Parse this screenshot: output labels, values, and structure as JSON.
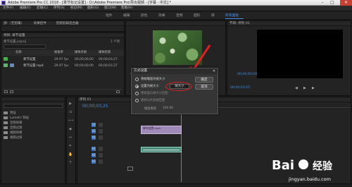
{
  "window": {
    "title": "Adobe Premiere Pro CC 2018 - [章节标记设置] - D:\\Adobe Premiere Pro\\导出视频 - [字幕 - 中文] *",
    "minimize": "–",
    "maximize": "□",
    "close": "✕"
  },
  "menu": [
    "文件(F)",
    "编辑(E)",
    "剪辑(C)",
    "序列(S)",
    "标记(M)",
    "图形(G)",
    "窗口(W)",
    "帮助(H)"
  ],
  "workspaces": [
    "组件",
    "编辑",
    "颜色",
    "效果",
    "音频",
    "图形",
    "库",
    "所有面板"
  ],
  "workspace_active": "所有面板",
  "source_panel": {
    "tab": "源:（无剪辑）",
    "tab2": "效果控件",
    "tab3": "音频剪辑混合器"
  },
  "program_panel": {
    "tab": "节目: 序列 01",
    "timecode_left": "00;00;03;25",
    "timecode_right": "00;00;03;25",
    "timecode_mid": "00;00;00;00"
  },
  "project_panel": {
    "title": "项目: 章节设置",
    "file": "章节设置.prproj",
    "count": "1 个项",
    "columns": [
      "名称",
      "帧速率",
      "媒体开始",
      "媒体结束"
    ],
    "items": [
      {
        "name": "章节设置",
        "fps": "29.97 fps",
        "start": "00;00;00;00",
        "end": "00;00;03;27",
        "color": "#3db349"
      },
      {
        "name": "章节设置.mp4",
        "fps": "29.97 fps",
        "start": "00;00;00;00",
        "end": "00;00;03;27",
        "color": "#6a87b6"
      }
    ]
  },
  "effects_panel": {
    "folders": [
      "预设",
      "Lumetri 预设",
      "音频效果",
      "音频过渡",
      "视频效果",
      "视频过渡"
    ]
  },
  "timeline": {
    "tab": "序列 01",
    "timecode": "00;00;03;25",
    "video_tracks": [
      "V3",
      "V2",
      "V1"
    ],
    "audio_tracks": [
      "A1",
      "A2",
      "A3"
    ],
    "clip_video": "章节设置.mp4",
    "clip_audio": ""
  },
  "dialog": {
    "title": "方式设置",
    "close": "✕",
    "options": [
      {
        "label": "将帧缩放为帧大小",
        "selected": false,
        "dim": false
      },
      {
        "label": "设置为帧大小",
        "selected": true,
        "dim": false
      },
      {
        "label": "使帧面与帧大小匹配",
        "selected": false,
        "dim": true
      },
      {
        "label": "使帧与片段帧匹配",
        "selected": false,
        "dim": true
      }
    ],
    "ok": "确定",
    "cancel": "取消",
    "value_box": "帧大小",
    "footer_label": "缩放重新",
    "footer_value": "100.00"
  },
  "watermark": {
    "brand": "Bai",
    "brand2": "经验",
    "url": "jingyan.baidu.com"
  }
}
